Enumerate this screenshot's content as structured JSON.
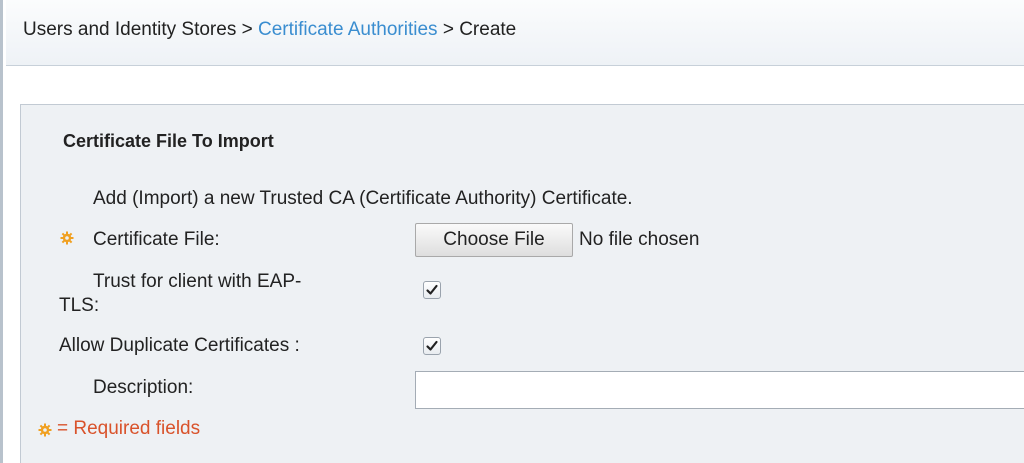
{
  "breadcrumb": {
    "item1": "Users and Identity Stores",
    "item2": "Certificate Authorities",
    "item3": "Create",
    "separator": ">"
  },
  "section": {
    "title": "Certificate File To Import",
    "intro": "Add (Import) a new Trusted CA (Certificate Authority) Certificate."
  },
  "fields": {
    "certificate_file_label": "Certificate File:",
    "choose_file_button": "Choose File",
    "file_status": "No file chosen",
    "trust_label_line1": "Trust for client with EAP-",
    "trust_label_line2": "TLS:",
    "trust_checked": true,
    "allow_duplicates_label": "Allow Duplicate Certificates :",
    "allow_duplicates_checked": true,
    "description_label": "Description:",
    "description_value": ""
  },
  "legend": {
    "required_text": "= Required fields"
  },
  "colors": {
    "link": "#3a8dd0",
    "required": "#d9532b",
    "required_icon": "#f0a020"
  },
  "icons": {
    "required": "required-field-gear-icon",
    "checkmark": "checkmark-icon"
  }
}
